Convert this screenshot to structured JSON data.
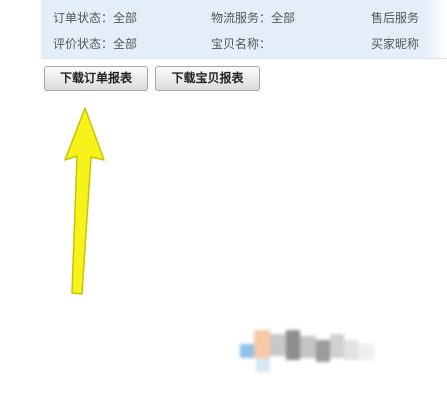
{
  "filters": {
    "row1": {
      "order_status": "订单状态：全部",
      "logistics_service": "物流服务：全部",
      "after_sales": "售后服务"
    },
    "row2": {
      "rating_status": "评价状态：全部",
      "item_name": "宝贝名称：",
      "buyer_nickname": "买家昵称"
    }
  },
  "buttons": {
    "download_orders": "下载订单报表",
    "download_items": "下载宝贝报表"
  },
  "colors": {
    "panel_bg": "#e4eef8",
    "arrow_fill": "#f7f21a",
    "arrow_stroke": "#c9c400"
  },
  "icons": {
    "annotation": "arrow-up-icon"
  }
}
